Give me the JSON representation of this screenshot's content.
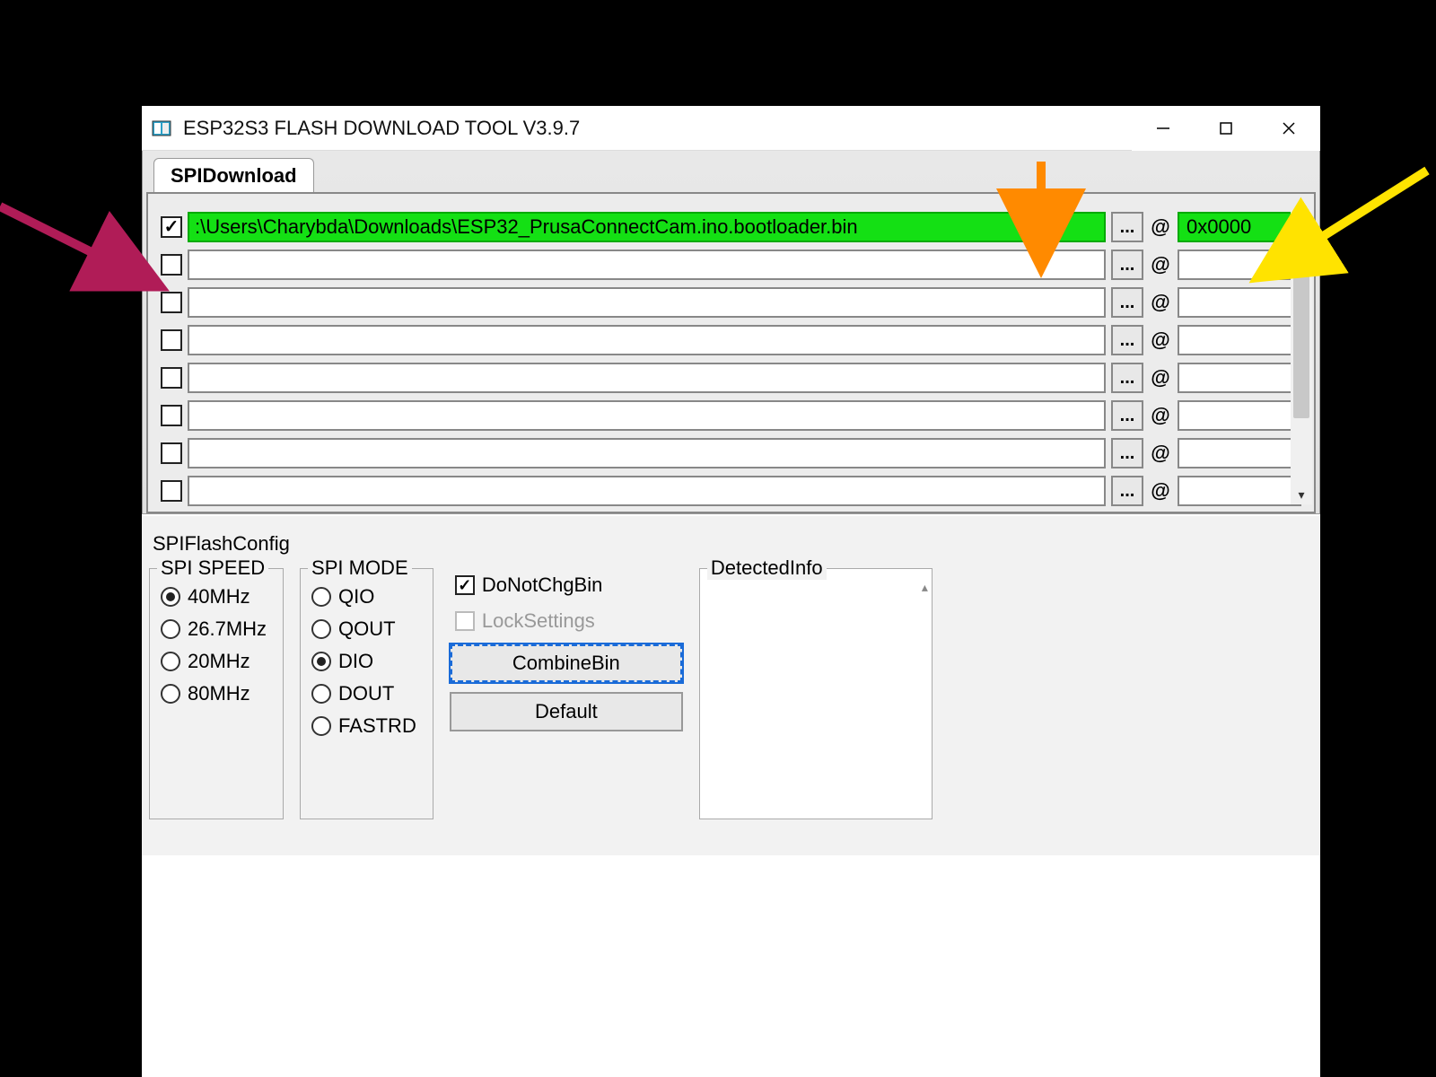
{
  "window": {
    "title": "ESP32S3 FLASH DOWNLOAD TOOL V3.9.7"
  },
  "tab": {
    "label": "SPIDownload"
  },
  "rows": [
    {
      "checked": true,
      "path": ":\\Users\\Charybda\\Downloads\\ESP32_PrusaConnectCam.ino.bootloader.bin",
      "addr": "0x0000",
      "hl": true
    },
    {
      "checked": false,
      "path": "",
      "addr": "",
      "hl": false
    },
    {
      "checked": false,
      "path": "",
      "addr": "",
      "hl": false
    },
    {
      "checked": false,
      "path": "",
      "addr": "",
      "hl": false
    },
    {
      "checked": false,
      "path": "",
      "addr": "",
      "hl": false
    },
    {
      "checked": false,
      "path": "",
      "addr": "",
      "hl": false
    },
    {
      "checked": false,
      "path": "",
      "addr": "",
      "hl": false
    },
    {
      "checked": false,
      "path": "",
      "addr": "",
      "hl": false
    }
  ],
  "browse_label": "...",
  "at_label": "@",
  "config": {
    "title": "SPIFlashConfig",
    "speed_title": "SPI SPEED",
    "speed": [
      "40MHz",
      "26.7MHz",
      "20MHz",
      "80MHz"
    ],
    "speed_sel": 0,
    "mode_title": "SPI MODE",
    "mode": [
      "QIO",
      "QOUT",
      "DIO",
      "DOUT",
      "FASTRD"
    ],
    "mode_sel": 2,
    "donotchg": "DoNotChgBin",
    "donotchg_checked": true,
    "lock": "LockSettings",
    "lock_enabled": false,
    "combine": "CombineBin",
    "default": "Default",
    "detected_title": "DetectedInfo"
  }
}
